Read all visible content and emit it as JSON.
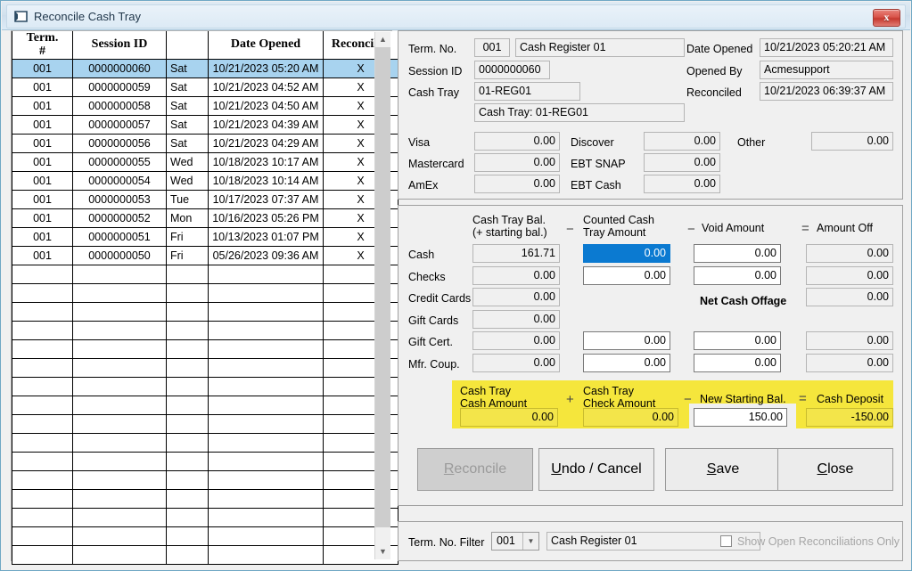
{
  "window": {
    "title": "Reconcile Cash Tray",
    "close_label": "x",
    "icon": "window-icon"
  },
  "grid": {
    "columns": [
      "Term. #",
      "Session ID",
      "",
      "Date Opened",
      "Reconciled"
    ],
    "col_term": "Term.",
    "col_term2": "#",
    "col_session": "Session ID",
    "col_blank": "",
    "col_date": "Date Opened",
    "col_reconciled": "Reconciled",
    "rows": [
      {
        "term": "001",
        "session": "0000000060",
        "dow": "Sat",
        "date": "10/21/2023 05:20 AM",
        "reconciled": "X",
        "selected": true
      },
      {
        "term": "001",
        "session": "0000000059",
        "dow": "Sat",
        "date": "10/21/2023 04:52 AM",
        "reconciled": "X",
        "selected": false
      },
      {
        "term": "001",
        "session": "0000000058",
        "dow": "Sat",
        "date": "10/21/2023 04:50 AM",
        "reconciled": "X",
        "selected": false
      },
      {
        "term": "001",
        "session": "0000000057",
        "dow": "Sat",
        "date": "10/21/2023 04:39 AM",
        "reconciled": "X",
        "selected": false
      },
      {
        "term": "001",
        "session": "0000000056",
        "dow": "Sat",
        "date": "10/21/2023 04:29 AM",
        "reconciled": "X",
        "selected": false
      },
      {
        "term": "001",
        "session": "0000000055",
        "dow": "Wed",
        "date": "10/18/2023 10:17 AM",
        "reconciled": "X",
        "selected": false
      },
      {
        "term": "001",
        "session": "0000000054",
        "dow": "Wed",
        "date": "10/18/2023 10:14 AM",
        "reconciled": "X",
        "selected": false
      },
      {
        "term": "001",
        "session": "0000000053",
        "dow": "Tue",
        "date": "10/17/2023 07:37 AM",
        "reconciled": "X",
        "selected": false
      },
      {
        "term": "001",
        "session": "0000000052",
        "dow": "Mon",
        "date": "10/16/2023 05:26 PM",
        "reconciled": "X",
        "selected": false
      },
      {
        "term": "001",
        "session": "0000000051",
        "dow": "Fri",
        "date": "10/13/2023 01:07 PM",
        "reconciled": "X",
        "selected": false
      },
      {
        "term": "001",
        "session": "0000000050",
        "dow": "Fri",
        "date": "05/26/2023 09:36 AM",
        "reconciled": "X",
        "selected": false
      },
      {
        "term": "",
        "session": "",
        "dow": "",
        "date": "",
        "reconciled": "",
        "selected": false
      },
      {
        "term": "",
        "session": "",
        "dow": "",
        "date": "",
        "reconciled": "",
        "selected": false
      },
      {
        "term": "",
        "session": "",
        "dow": "",
        "date": "",
        "reconciled": "",
        "selected": false
      },
      {
        "term": "",
        "session": "",
        "dow": "",
        "date": "",
        "reconciled": "",
        "selected": false
      },
      {
        "term": "",
        "session": "",
        "dow": "",
        "date": "",
        "reconciled": "",
        "selected": false
      },
      {
        "term": "",
        "session": "",
        "dow": "",
        "date": "",
        "reconciled": "",
        "selected": false
      },
      {
        "term": "",
        "session": "",
        "dow": "",
        "date": "",
        "reconciled": "",
        "selected": false
      },
      {
        "term": "",
        "session": "",
        "dow": "",
        "date": "",
        "reconciled": "",
        "selected": false
      },
      {
        "term": "",
        "session": "",
        "dow": "",
        "date": "",
        "reconciled": "",
        "selected": false
      },
      {
        "term": "",
        "session": "",
        "dow": "",
        "date": "",
        "reconciled": "",
        "selected": false
      },
      {
        "term": "",
        "session": "",
        "dow": "",
        "date": "",
        "reconciled": "",
        "selected": false
      },
      {
        "term": "",
        "session": "",
        "dow": "",
        "date": "",
        "reconciled": "",
        "selected": false
      },
      {
        "term": "",
        "session": "",
        "dow": "",
        "date": "",
        "reconciled": "",
        "selected": false
      },
      {
        "term": "",
        "session": "",
        "dow": "",
        "date": "",
        "reconciled": "",
        "selected": false
      },
      {
        "term": "",
        "session": "",
        "dow": "",
        "date": "",
        "reconciled": "",
        "selected": false
      },
      {
        "term": "",
        "session": "",
        "dow": "",
        "date": "",
        "reconciled": "",
        "selected": false
      }
    ],
    "scroll_up_icon": "chevron-up-icon",
    "scroll_down_icon": "chevron-down-icon"
  },
  "session_info": {
    "term_no_label": "Term. No.",
    "term_no_value": "001",
    "term_name_value": "Cash Register 01",
    "session_id_label": "Session ID",
    "session_id_value": "0000000060",
    "cash_tray_label": "Cash Tray",
    "cash_tray_value": "01-REG01",
    "cash_tray_desc_value": "Cash Tray: 01-REG01",
    "date_opened_label": "Date Opened",
    "date_opened_value": "10/21/2023 05:20:21 AM",
    "opened_by_label": "Opened By",
    "opened_by_value": "Acmesupport",
    "reconciled_label": "Reconciled",
    "reconciled_value": "10/21/2023 06:39:37 AM"
  },
  "tenders": {
    "visa_label": "Visa",
    "visa_value": "0.00",
    "mastercard_label": "Mastercard",
    "mastercard_value": "0.00",
    "amex_label": "AmEx",
    "amex_value": "0.00",
    "discover_label": "Discover",
    "discover_value": "0.00",
    "ebt_snap_label": "EBT SNAP",
    "ebt_snap_value": "0.00",
    "ebt_cash_label": "EBT Cash",
    "ebt_cash_value": "0.00",
    "other_label": "Other",
    "other_value": "0.00"
  },
  "reconcile": {
    "col1_line1": "Cash Tray Bal.",
    "col1_line2": "(+ starting bal.)",
    "op1": "−",
    "col2_line1": "Counted Cash",
    "col2_line2": "Tray Amount",
    "op2": "−",
    "col3": "Void Amount",
    "op3": "=",
    "col4": "Amount Off",
    "net_cash_offage_label": "Net Cash Offage",
    "net_cash_offage_value": "0.00",
    "rows": [
      {
        "label": "Cash",
        "bal": "161.71",
        "counted": "0.00",
        "void": "0.00",
        "off": "0.00",
        "counted_focus": true,
        "has_counted": true,
        "has_void": true,
        "has_off": true
      },
      {
        "label": "Checks",
        "bal": "0.00",
        "counted": "0.00",
        "void": "0.00",
        "off": "0.00",
        "counted_focus": false,
        "has_counted": true,
        "has_void": true,
        "has_off": true
      },
      {
        "label": "Credit Cards",
        "bal": "0.00",
        "counted": "",
        "void": "",
        "off": "",
        "counted_focus": false,
        "has_counted": false,
        "has_void": false,
        "has_off": false
      },
      {
        "label": "Gift Cards",
        "bal": "0.00",
        "counted": "",
        "void": "",
        "off": "",
        "counted_focus": false,
        "has_counted": false,
        "has_void": false,
        "has_off": false
      },
      {
        "label": "Gift Cert.",
        "bal": "0.00",
        "counted": "0.00",
        "void": "0.00",
        "off": "0.00",
        "counted_focus": false,
        "has_counted": true,
        "has_void": true,
        "has_off": true
      },
      {
        "label": "Mfr. Coup.",
        "bal": "0.00",
        "counted": "0.00",
        "void": "0.00",
        "off": "0.00",
        "counted_focus": false,
        "has_counted": true,
        "has_void": true,
        "has_off": true
      }
    ]
  },
  "deposit": {
    "c1_line1": "Cash Tray",
    "c1_line2": "Cash Amount",
    "op1": "+",
    "c2_line1": "Cash Tray",
    "c2_line2": "Check Amount",
    "op2": "−",
    "c3": "New Starting Bal.",
    "op3": "=",
    "c4": "Cash Deposit",
    "cash_amount_value": "0.00",
    "check_amount_value": "0.00",
    "new_starting_bal_value": "150.00",
    "cash_deposit_value": "-150.00"
  },
  "buttons": {
    "reconcile": "Reconcile",
    "reconcile_accel": "R",
    "reconcile_rest": "econcile",
    "undo": "Undo / Cancel",
    "undo_accel": "U",
    "undo_rest": "ndo / Cancel",
    "save": "Save",
    "save_accel": "S",
    "save_rest": "ave",
    "close": "Close",
    "close_accel": "C",
    "close_rest": "lose"
  },
  "filter": {
    "label": "Term. No. Filter",
    "term_value": "001",
    "term_name": "Cash Register 01",
    "checkbox_label": "Show Open Reconciliations Only",
    "checkbox_checked": false
  }
}
